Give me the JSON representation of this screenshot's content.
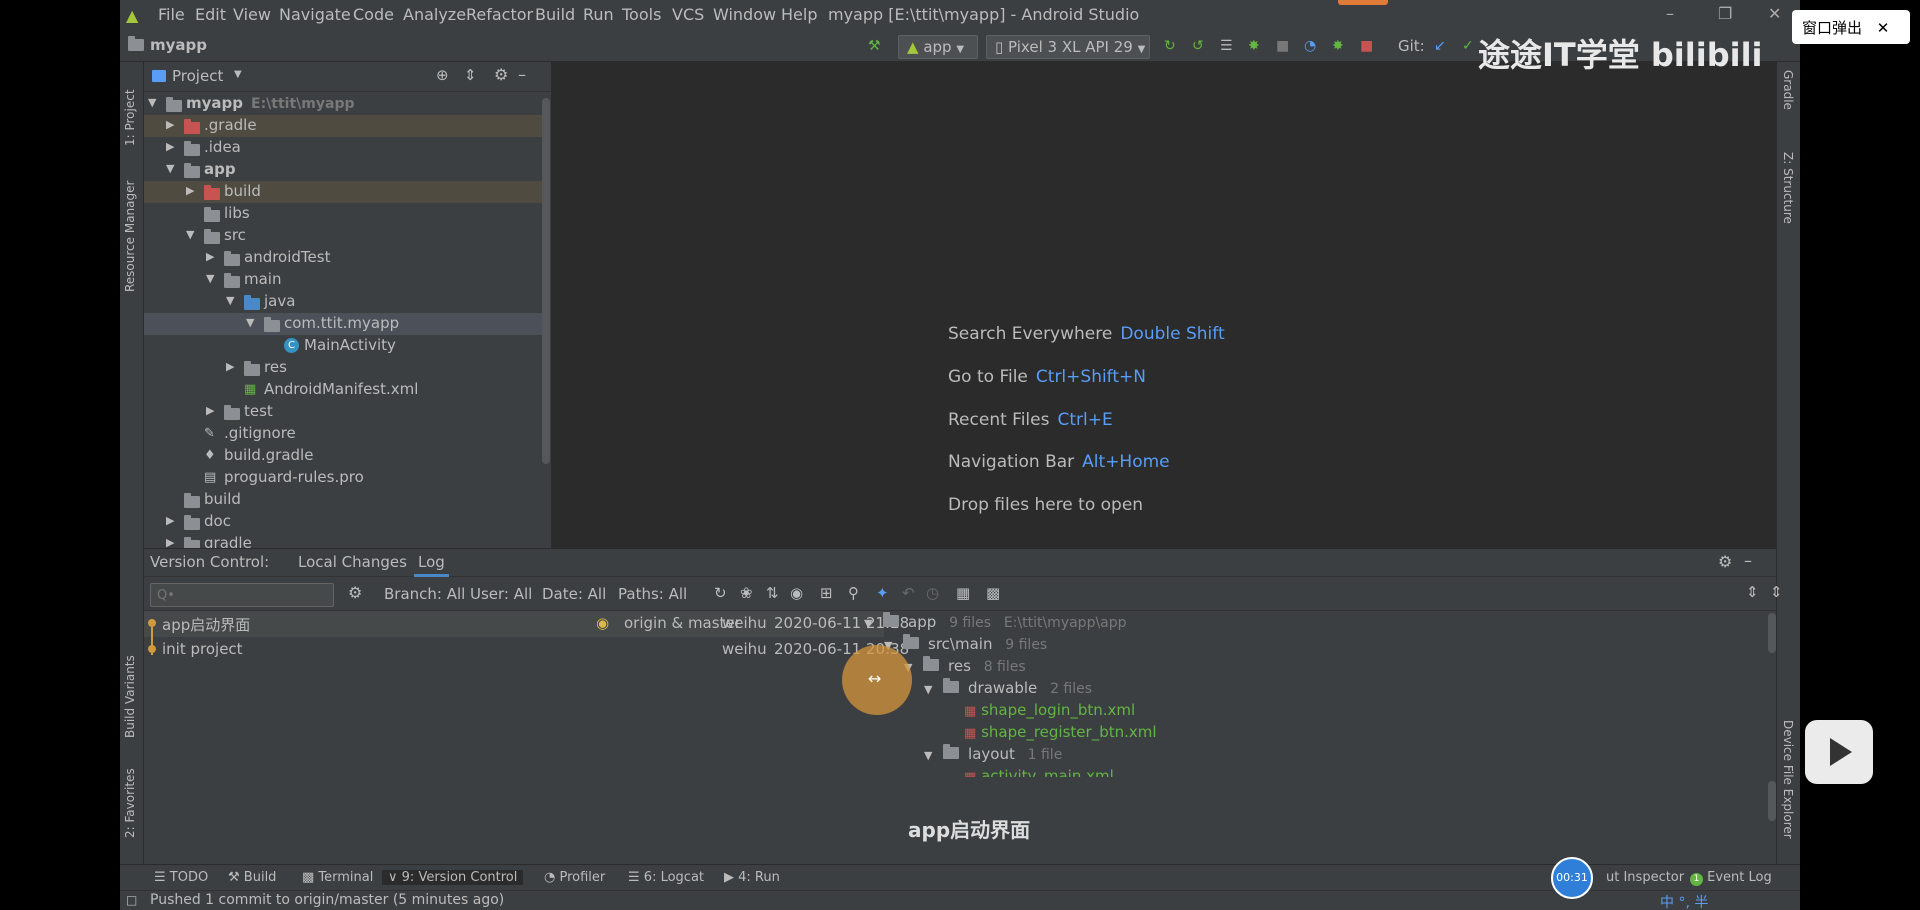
{
  "menu": [
    "File",
    "Edit",
    "View",
    "Navigate",
    "Code",
    "Analyze",
    "Refactor",
    "Build",
    "Run",
    "Tools",
    "VCS",
    "Window",
    "Help"
  ],
  "window_title": "myapp [E:\\ttit\\myapp] - Android Studio",
  "navbar": {
    "project_name": "myapp",
    "run_config": "app",
    "device": "Pixel 3 XL API 29",
    "git_label": "Git:"
  },
  "left_tabs": [
    "1: Project",
    "Resource Manager",
    "Build Variants",
    "2: Favorites"
  ],
  "right_tabs": [
    "Gradle",
    "Z: Structure",
    "Device File Explorer"
  ],
  "project_panel": {
    "title": "Project",
    "tree": [
      {
        "label": "myapp",
        "hint": "E:\\ttit\\myapp"
      },
      {
        "label": ".gradle"
      },
      {
        "label": ".idea"
      },
      {
        "label": "app"
      },
      {
        "label": "build"
      },
      {
        "label": "libs"
      },
      {
        "label": "src"
      },
      {
        "label": "androidTest"
      },
      {
        "label": "main"
      },
      {
        "label": "java"
      },
      {
        "label": "com.ttit.myapp"
      },
      {
        "label": "MainActivity"
      },
      {
        "label": "res"
      },
      {
        "label": "AndroidManifest.xml"
      },
      {
        "label": "test"
      },
      {
        "label": ".gitignore"
      },
      {
        "label": "build.gradle"
      },
      {
        "label": "proguard-rules.pro"
      },
      {
        "label": "build"
      },
      {
        "label": "doc"
      },
      {
        "label": "gradle"
      }
    ]
  },
  "editor_tips": [
    {
      "text": "Search Everywhere",
      "key": "Double Shift"
    },
    {
      "text": "Go to File",
      "key": "Ctrl+Shift+N"
    },
    {
      "text": "Recent Files",
      "key": "Ctrl+E"
    },
    {
      "text": "Navigation Bar",
      "key": "Alt+Home"
    },
    {
      "text": "Drop files here to open",
      "key": ""
    }
  ],
  "version_control": {
    "label": "Version Control:",
    "tabs": [
      "Local Changes",
      "Log"
    ],
    "search_placeholder": "Q•",
    "filters": [
      "Branch: All",
      "User: All",
      "Date: All",
      "Paths: All"
    ],
    "commits": [
      {
        "message": "app启动界面",
        "refs": "origin & master",
        "author": "weihu",
        "date": "2020-06-11 21:28"
      },
      {
        "message": "init project",
        "refs": "",
        "author": "weihu",
        "date": "2020-06-11 20:38"
      }
    ],
    "changes": {
      "app": {
        "name": "app",
        "count": "9 files",
        "path": "E:\\ttit\\myapp\\app"
      },
      "srcmain": {
        "name": "src\\main",
        "count": "9 files"
      },
      "res": {
        "name": "res",
        "count": "8 files"
      },
      "drawable": {
        "name": "drawable",
        "count": "2 files"
      },
      "file1": "shape_login_btn.xml",
      "file2": "shape_register_btn.xml",
      "layout": {
        "name": "layout",
        "count": "1 file"
      },
      "file3": "activity_main.xml"
    }
  },
  "bottom_tabs": [
    "TODO",
    "Build",
    "Terminal",
    "9: Version Control",
    "Profiler",
    "6: Logcat",
    "4: Run"
  ],
  "bottom_right": [
    "ut Inspector",
    "Event Log"
  ],
  "status_text": "Pushed 1 commit to origin/master (5 minutes ago)",
  "overlay": {
    "popout": "窗口弹出",
    "watermark": "途途IT学堂  bilibili",
    "subtitle": "app启动界面",
    "timer": "00:31",
    "ime": "中 °, 半"
  },
  "colors": {
    "accent": "#589df6",
    "git_added": "#62b543",
    "panel": "#3c3f41",
    "editor": "#2b2b2b"
  }
}
